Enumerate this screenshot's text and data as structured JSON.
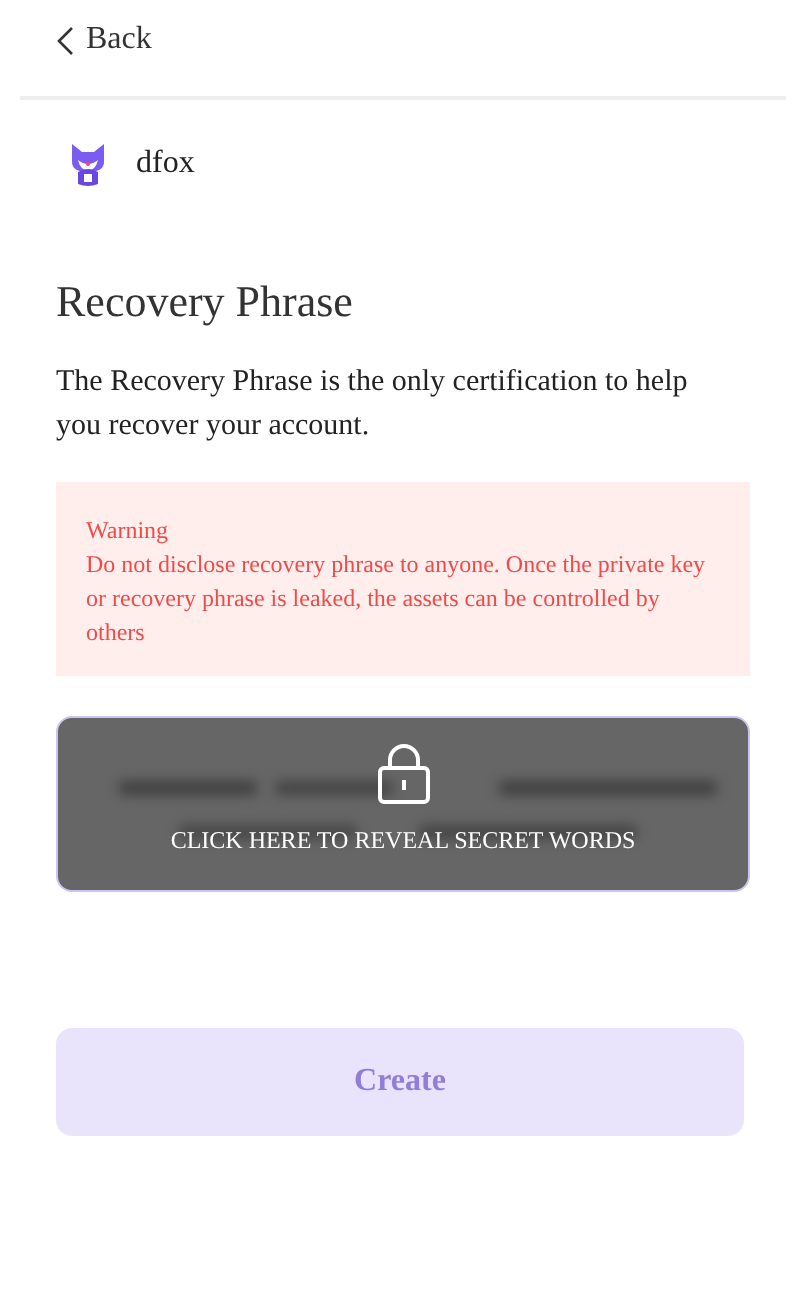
{
  "header": {
    "back_label": "Back"
  },
  "account": {
    "name": "dfox"
  },
  "title": "Recovery Phrase",
  "description": "The Recovery Phrase is the only certification to help you recover your account.",
  "warning": {
    "heading": "Warning",
    "text": "Do not disclose recovery phrase to anyone. Once the private key or recovery phrase is leaked, the assets can be controlled by others"
  },
  "reveal": {
    "label": "CLICK HERE TO REVEAL SECRET WORDS",
    "revealed": false
  },
  "create_button": {
    "label": "Create",
    "disabled": true
  }
}
